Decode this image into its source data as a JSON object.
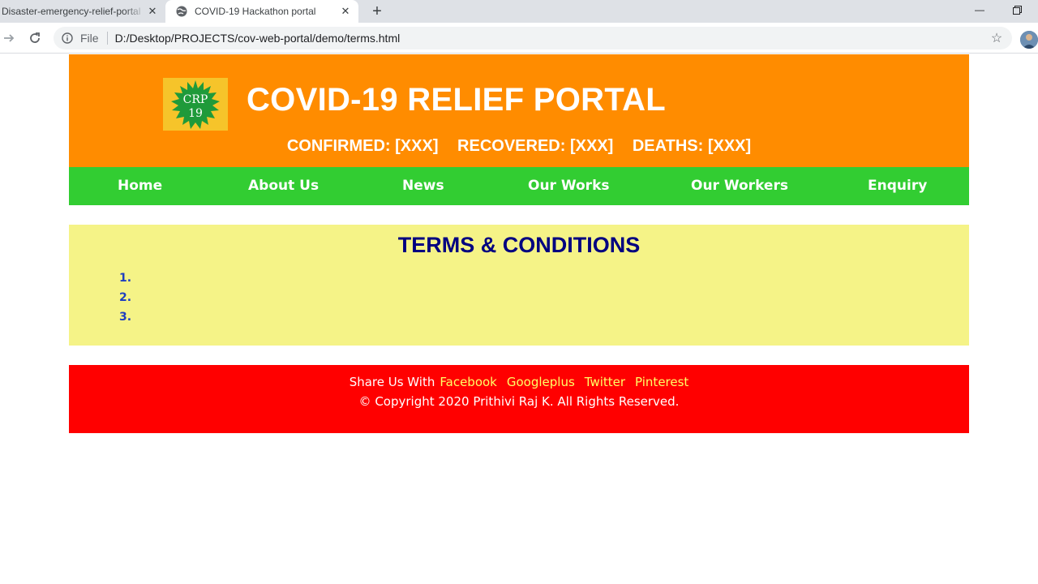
{
  "browser": {
    "tabs": [
      {
        "title": "Disaster-emergency-relief-portal",
        "active": false
      },
      {
        "title": "COVID-19 Hackathon portal",
        "active": true
      }
    ],
    "address": {
      "scheme_label": "File",
      "url": "D:/Desktop/PROJECTS/cov-web-portal/demo/terms.html"
    }
  },
  "site": {
    "logo_text_line1": "CRP",
    "logo_text_line2": "19",
    "title": "COVID-19 RELIEF PORTAL",
    "stats": {
      "confirmed": "CONFIRMED: [XXX]",
      "recovered": "RECOVERED: [XXX]",
      "deaths": "DEATHS: [XXX]"
    },
    "nav": [
      {
        "label": "Home"
      },
      {
        "label": "About Us"
      },
      {
        "label": "News"
      },
      {
        "label": "Our Works"
      },
      {
        "label": "Our Workers"
      },
      {
        "label": "Enquiry"
      }
    ]
  },
  "terms": {
    "heading": "TERMS & CONDITIONS",
    "items": [
      "1.",
      "2.",
      "3."
    ]
  },
  "footer": {
    "share_prefix": "Share Us With",
    "links": [
      "Facebook",
      "Googleplus",
      "Twitter",
      "Pinterest"
    ],
    "copyright": "© Copyright 2020 Prithivi Raj K. All Rights Reserved."
  },
  "colors": {
    "header_bg": "#ff8c00",
    "nav_bg": "#32cd32",
    "content_bg": "#f5f387",
    "footer_bg": "#ff0000",
    "heading_color": "#000080"
  }
}
